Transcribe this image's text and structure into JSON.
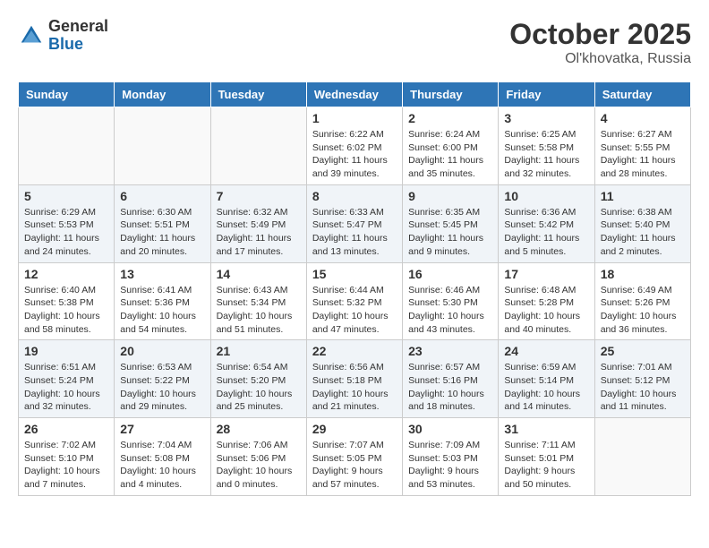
{
  "logo": {
    "general": "General",
    "blue": "Blue"
  },
  "title": "October 2025",
  "location": "Ol'khovatka, Russia",
  "weekdays": [
    "Sunday",
    "Monday",
    "Tuesday",
    "Wednesday",
    "Thursday",
    "Friday",
    "Saturday"
  ],
  "weeks": [
    [
      {
        "day": "",
        "info": ""
      },
      {
        "day": "",
        "info": ""
      },
      {
        "day": "",
        "info": ""
      },
      {
        "day": "1",
        "info": "Sunrise: 6:22 AM\nSunset: 6:02 PM\nDaylight: 11 hours\nand 39 minutes."
      },
      {
        "day": "2",
        "info": "Sunrise: 6:24 AM\nSunset: 6:00 PM\nDaylight: 11 hours\nand 35 minutes."
      },
      {
        "day": "3",
        "info": "Sunrise: 6:25 AM\nSunset: 5:58 PM\nDaylight: 11 hours\nand 32 minutes."
      },
      {
        "day": "4",
        "info": "Sunrise: 6:27 AM\nSunset: 5:55 PM\nDaylight: 11 hours\nand 28 minutes."
      }
    ],
    [
      {
        "day": "5",
        "info": "Sunrise: 6:29 AM\nSunset: 5:53 PM\nDaylight: 11 hours\nand 24 minutes."
      },
      {
        "day": "6",
        "info": "Sunrise: 6:30 AM\nSunset: 5:51 PM\nDaylight: 11 hours\nand 20 minutes."
      },
      {
        "day": "7",
        "info": "Sunrise: 6:32 AM\nSunset: 5:49 PM\nDaylight: 11 hours\nand 17 minutes."
      },
      {
        "day": "8",
        "info": "Sunrise: 6:33 AM\nSunset: 5:47 PM\nDaylight: 11 hours\nand 13 minutes."
      },
      {
        "day": "9",
        "info": "Sunrise: 6:35 AM\nSunset: 5:45 PM\nDaylight: 11 hours\nand 9 minutes."
      },
      {
        "day": "10",
        "info": "Sunrise: 6:36 AM\nSunset: 5:42 PM\nDaylight: 11 hours\nand 5 minutes."
      },
      {
        "day": "11",
        "info": "Sunrise: 6:38 AM\nSunset: 5:40 PM\nDaylight: 11 hours\nand 2 minutes."
      }
    ],
    [
      {
        "day": "12",
        "info": "Sunrise: 6:40 AM\nSunset: 5:38 PM\nDaylight: 10 hours\nand 58 minutes."
      },
      {
        "day": "13",
        "info": "Sunrise: 6:41 AM\nSunset: 5:36 PM\nDaylight: 10 hours\nand 54 minutes."
      },
      {
        "day": "14",
        "info": "Sunrise: 6:43 AM\nSunset: 5:34 PM\nDaylight: 10 hours\nand 51 minutes."
      },
      {
        "day": "15",
        "info": "Sunrise: 6:44 AM\nSunset: 5:32 PM\nDaylight: 10 hours\nand 47 minutes."
      },
      {
        "day": "16",
        "info": "Sunrise: 6:46 AM\nSunset: 5:30 PM\nDaylight: 10 hours\nand 43 minutes."
      },
      {
        "day": "17",
        "info": "Sunrise: 6:48 AM\nSunset: 5:28 PM\nDaylight: 10 hours\nand 40 minutes."
      },
      {
        "day": "18",
        "info": "Sunrise: 6:49 AM\nSunset: 5:26 PM\nDaylight: 10 hours\nand 36 minutes."
      }
    ],
    [
      {
        "day": "19",
        "info": "Sunrise: 6:51 AM\nSunset: 5:24 PM\nDaylight: 10 hours\nand 32 minutes."
      },
      {
        "day": "20",
        "info": "Sunrise: 6:53 AM\nSunset: 5:22 PM\nDaylight: 10 hours\nand 29 minutes."
      },
      {
        "day": "21",
        "info": "Sunrise: 6:54 AM\nSunset: 5:20 PM\nDaylight: 10 hours\nand 25 minutes."
      },
      {
        "day": "22",
        "info": "Sunrise: 6:56 AM\nSunset: 5:18 PM\nDaylight: 10 hours\nand 21 minutes."
      },
      {
        "day": "23",
        "info": "Sunrise: 6:57 AM\nSunset: 5:16 PM\nDaylight: 10 hours\nand 18 minutes."
      },
      {
        "day": "24",
        "info": "Sunrise: 6:59 AM\nSunset: 5:14 PM\nDaylight: 10 hours\nand 14 minutes."
      },
      {
        "day": "25",
        "info": "Sunrise: 7:01 AM\nSunset: 5:12 PM\nDaylight: 10 hours\nand 11 minutes."
      }
    ],
    [
      {
        "day": "26",
        "info": "Sunrise: 7:02 AM\nSunset: 5:10 PM\nDaylight: 10 hours\nand 7 minutes."
      },
      {
        "day": "27",
        "info": "Sunrise: 7:04 AM\nSunset: 5:08 PM\nDaylight: 10 hours\nand 4 minutes."
      },
      {
        "day": "28",
        "info": "Sunrise: 7:06 AM\nSunset: 5:06 PM\nDaylight: 10 hours\nand 0 minutes."
      },
      {
        "day": "29",
        "info": "Sunrise: 7:07 AM\nSunset: 5:05 PM\nDaylight: 9 hours\nand 57 minutes."
      },
      {
        "day": "30",
        "info": "Sunrise: 7:09 AM\nSunset: 5:03 PM\nDaylight: 9 hours\nand 53 minutes."
      },
      {
        "day": "31",
        "info": "Sunrise: 7:11 AM\nSunset: 5:01 PM\nDaylight: 9 hours\nand 50 minutes."
      },
      {
        "day": "",
        "info": ""
      }
    ]
  ]
}
